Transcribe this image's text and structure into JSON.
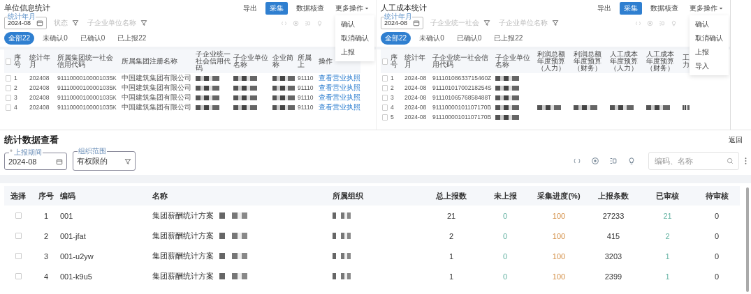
{
  "panels": [
    {
      "title": "单位信息统计",
      "actions": [
        {
          "label": "导出",
          "primary": false
        },
        {
          "label": "采集",
          "primary": true
        },
        {
          "label": "数据核查",
          "primary": false
        }
      ],
      "more": "更多操作",
      "menu": [
        "确认",
        "取消确认",
        "上报"
      ],
      "period": {
        "label": "统计年月",
        "value": "2024-08"
      },
      "filters": [
        {
          "placeholder": "状态"
        },
        {
          "placeholder": "子企业单位名称"
        }
      ],
      "tabs": [
        {
          "label": "全部22",
          "selected": true
        },
        {
          "label": "未确认0",
          "selected": false
        },
        {
          "label": "已确认0",
          "selected": false
        },
        {
          "label": "已上报22",
          "selected": false
        }
      ],
      "all_checked": false,
      "columns": [
        "序号",
        "统计年月",
        "所属集团统一社会信用代码",
        "所属集团注册名称",
        "子企业统一社会信用代码",
        "子企业单位名称",
        "企业简称",
        "所属上",
        "操作"
      ],
      "rows": [
        {
          "checked": false,
          "cells": [
            {
              "kind": "text",
              "text": "1"
            },
            {
              "kind": "text",
              "text": "202408"
            },
            {
              "kind": "text",
              "text": "91110000100001035K"
            },
            {
              "kind": "text",
              "text": "中国建筑集团有限公司"
            },
            {
              "kind": "redacted"
            },
            {
              "kind": "redacted"
            },
            {
              "kind": "redacted"
            },
            {
              "kind": "text",
              "text": "91110"
            },
            {
              "kind": "link",
              "text": "查看营业执照"
            }
          ]
        },
        {
          "checked": false,
          "cells": [
            {
              "kind": "text",
              "text": "2"
            },
            {
              "kind": "text",
              "text": "202408"
            },
            {
              "kind": "text",
              "text": "91110000100001035K"
            },
            {
              "kind": "text",
              "text": "中国建筑集团有限公司"
            },
            {
              "kind": "redacted"
            },
            {
              "kind": "redacted"
            },
            {
              "kind": "redacted"
            },
            {
              "kind": "text",
              "text": "91110"
            },
            {
              "kind": "link",
              "text": "查看营业执照"
            }
          ]
        },
        {
          "checked": false,
          "cells": [
            {
              "kind": "text",
              "text": "3"
            },
            {
              "kind": "text",
              "text": "202408"
            },
            {
              "kind": "text",
              "text": "91110000100001035K"
            },
            {
              "kind": "text",
              "text": "中国建筑集团有限公司"
            },
            {
              "kind": "redacted"
            },
            {
              "kind": "redacted"
            },
            {
              "kind": "redacted"
            },
            {
              "kind": "text",
              "text": "91110"
            },
            {
              "kind": "link",
              "text": "查看营业执照"
            }
          ]
        },
        {
          "checked": false,
          "cells": [
            {
              "kind": "text",
              "text": "4"
            },
            {
              "kind": "text",
              "text": "202408"
            },
            {
              "kind": "text",
              "text": "91110000100001035K"
            },
            {
              "kind": "text",
              "text": "中国建筑集团有限公司"
            },
            {
              "kind": "redacted"
            },
            {
              "kind": "redacted"
            },
            {
              "kind": "redacted"
            },
            {
              "kind": "text",
              "text": "91110"
            },
            {
              "kind": "link",
              "text": "查看营业执照"
            }
          ]
        }
      ]
    },
    {
      "title": "人工成本统计",
      "actions": [
        {
          "label": "导出",
          "primary": false
        },
        {
          "label": "采集",
          "primary": true
        },
        {
          "label": "数据核查",
          "primary": false
        }
      ],
      "more": "更多操作",
      "menu": [
        "确认",
        "取消确认",
        "上报",
        "导入"
      ],
      "period": {
        "label": "统计年月",
        "value": "2024-08"
      },
      "filters": [
        {
          "placeholder": "子企业统一社会"
        },
        {
          "placeholder": "子企业单位名称"
        }
      ],
      "tabs": [
        {
          "label": "全部22",
          "selected": true
        },
        {
          "label": "未确认0",
          "selected": false
        },
        {
          "label": "已确认0",
          "selected": false
        },
        {
          "label": "已上报22",
          "selected": false
        }
      ],
      "all_checked": false,
      "columns": [
        "序号",
        "统计年月",
        "子企业统一社会信用代码",
        "子企业单位名称",
        "利润总额年度预算（人力）",
        "利润总额年度预算（财务）",
        "人工成本年度预算（人力）",
        "人工成本年度预算（财务）",
        "工力"
      ],
      "rows": [
        {
          "checked": false,
          "cells": [
            {
              "kind": "text",
              "text": "1"
            },
            {
              "kind": "text",
              "text": "2024-08"
            },
            {
              "kind": "text",
              "text": "91110108633715460Z"
            },
            {
              "kind": "redacted"
            },
            {
              "kind": "empty"
            },
            {
              "kind": "empty"
            },
            {
              "kind": "empty"
            },
            {
              "kind": "empty"
            },
            {
              "kind": "empty"
            }
          ]
        },
        {
          "checked": false,
          "cells": [
            {
              "kind": "text",
              "text": "2"
            },
            {
              "kind": "text",
              "text": "2024-08"
            },
            {
              "kind": "text",
              "text": "91110101700218254S"
            },
            {
              "kind": "redacted"
            },
            {
              "kind": "empty"
            },
            {
              "kind": "empty"
            },
            {
              "kind": "empty"
            },
            {
              "kind": "empty"
            },
            {
              "kind": "empty"
            }
          ]
        },
        {
          "checked": false,
          "cells": [
            {
              "kind": "text",
              "text": "3"
            },
            {
              "kind": "text",
              "text": "2024-08"
            },
            {
              "kind": "text",
              "text": "91110106576858488T"
            },
            {
              "kind": "redacted"
            },
            {
              "kind": "empty"
            },
            {
              "kind": "empty"
            },
            {
              "kind": "empty"
            },
            {
              "kind": "empty"
            },
            {
              "kind": "empty"
            }
          ]
        },
        {
          "checked": false,
          "cells": [
            {
              "kind": "text",
              "text": "4"
            },
            {
              "kind": "text",
              "text": "2024-08"
            },
            {
              "kind": "text",
              "text": "91110000101107170B"
            },
            {
              "kind": "redacted"
            },
            {
              "kind": "redacted"
            },
            {
              "kind": "redacted"
            },
            {
              "kind": "redacted"
            },
            {
              "kind": "redacted"
            },
            {
              "kind": "redacted"
            }
          ]
        },
        {
          "checked": false,
          "cells": [
            {
              "kind": "text",
              "text": "5"
            },
            {
              "kind": "text",
              "text": "2024-08"
            },
            {
              "kind": "text",
              "text": "91110000101107170B"
            },
            {
              "kind": "redacted"
            },
            {
              "kind": "empty"
            },
            {
              "kind": "empty"
            },
            {
              "kind": "empty"
            },
            {
              "kind": "empty"
            },
            {
              "kind": "empty"
            }
          ]
        }
      ]
    }
  ],
  "main": {
    "title": "统计数据查看",
    "back": "返回",
    "period": {
      "label": "上报期间",
      "required_mark": "*",
      "value": "2024-08"
    },
    "scope": {
      "label": "组织范围",
      "value": "有权限的"
    },
    "search": {
      "placeholder": "编码、名称"
    },
    "columns": [
      "选择",
      "序号",
      "编码",
      "名称",
      "所属组织",
      "总上报数",
      "未上报",
      "采集进度(%)",
      "上报条数",
      "已审核",
      "待审核"
    ],
    "rows": [
      {
        "checked": false,
        "index": "1",
        "code": "001",
        "name": "集团薪酬统计方案",
        "name_redacted": true,
        "org_redacted": true,
        "total": "21",
        "unreported": "0",
        "progress": "100",
        "count": "27233",
        "approved": "21",
        "pending": "0"
      },
      {
        "checked": false,
        "index": "2",
        "code": "001-jfat",
        "name": "集团薪酬统计方案",
        "name_redacted": true,
        "org_redacted": true,
        "total": "2",
        "unreported": "0",
        "progress": "100",
        "count": "415",
        "approved": "2",
        "pending": "0"
      },
      {
        "checked": false,
        "index": "3",
        "code": "001-u2yw",
        "name": "集团薪酬统计方案",
        "name_redacted": true,
        "org_redacted": true,
        "total": "1",
        "unreported": "0",
        "progress": "100",
        "count": "3203",
        "approved": "1",
        "pending": "0"
      },
      {
        "checked": false,
        "index": "4",
        "code": "001-k9u5",
        "name": "集团薪酬统计方案",
        "name_redacted": true,
        "org_redacted": true,
        "total": "1",
        "unreported": "0",
        "progress": "100",
        "count": "2399",
        "approved": "1",
        "pending": "0"
      }
    ]
  }
}
